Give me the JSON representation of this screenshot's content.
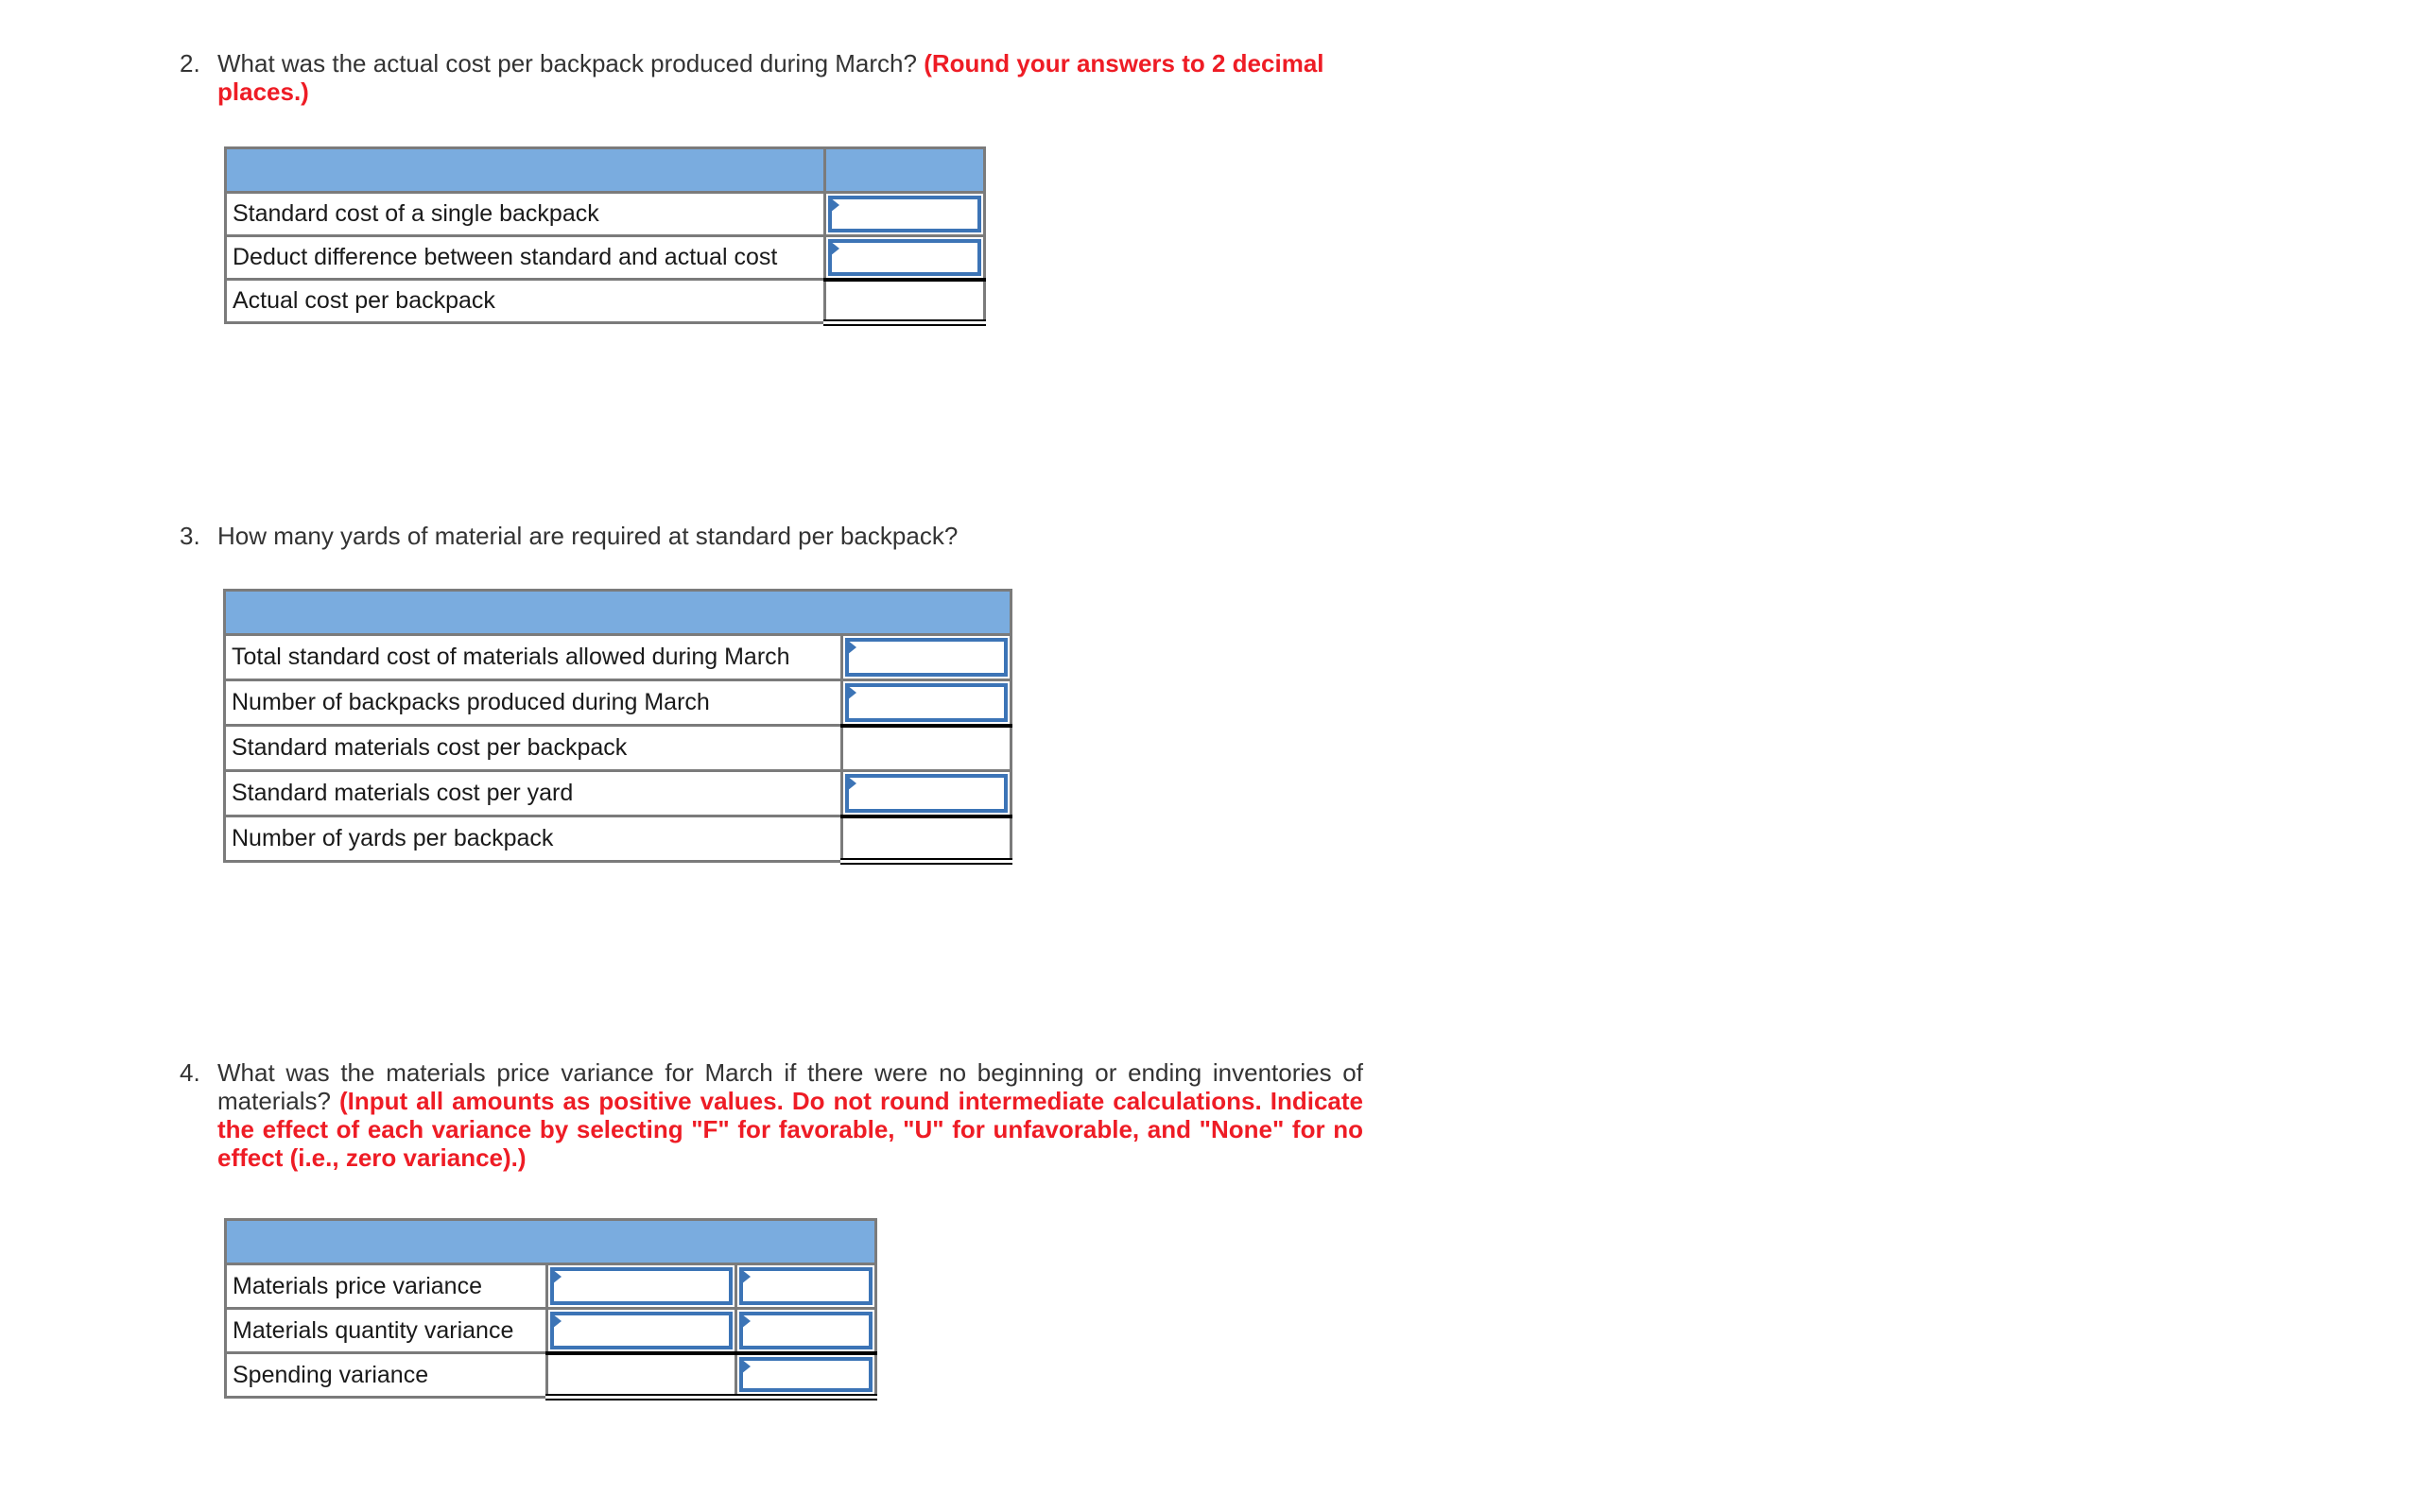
{
  "q2": {
    "number": "2.",
    "text": "What was the actual cost per backpack produced during March?",
    "instruction": "(Round your answers to 2 decimal places.)",
    "table": {
      "rows": [
        {
          "label": "Standard cost of a single backpack",
          "value": "",
          "editable": true
        },
        {
          "label": "Deduct difference between standard and actual cost",
          "value": "",
          "editable": true
        },
        {
          "label": "Actual cost per backpack",
          "value": "",
          "editable": false
        }
      ]
    }
  },
  "q3": {
    "number": "3.",
    "text": "How many yards of material are required at standard per backpack?",
    "table": {
      "rows": [
        {
          "label": "Total standard cost of materials allowed during March",
          "value": "",
          "editable": true
        },
        {
          "label": "Number of backpacks produced during March",
          "value": "",
          "editable": true
        },
        {
          "label": "Standard materials cost per backpack",
          "value": "",
          "editable": false
        },
        {
          "label": "Standard materials cost per yard",
          "value": "",
          "editable": true
        },
        {
          "label": "Number of yards per backpack",
          "value": "",
          "editable": false
        }
      ]
    }
  },
  "q4": {
    "number": "4.",
    "text": "What was the materials price variance for March if there were no beginning or ending inventories of materials?",
    "instruction": "(Input all amounts as positive values. Do not round intermediate calculations. Indicate the effect of each variance by selecting \"F\" for favorable, \"U\" for unfavorable, and \"None\" for no effect (i.e., zero variance).)",
    "table": {
      "rows": [
        {
          "label": "Materials price variance",
          "amount": "",
          "effect": ""
        },
        {
          "label": "Materials quantity variance",
          "amount": "",
          "effect": ""
        },
        {
          "label": "Spending variance",
          "amount": "",
          "effect": ""
        }
      ]
    }
  },
  "colors": {
    "header_blue": "#7aacdf",
    "input_border": "#3c74b6",
    "instruction_red": "#ee1c25"
  }
}
